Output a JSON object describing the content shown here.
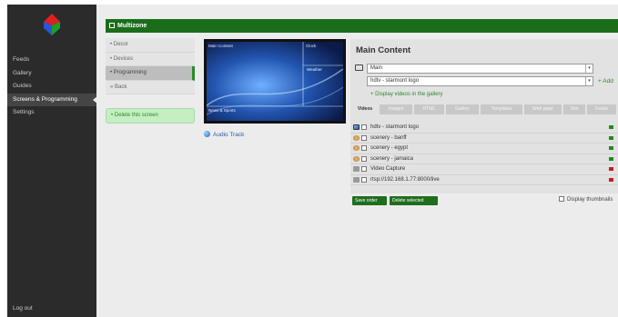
{
  "sidebar": {
    "items": [
      {
        "label": "Feeds"
      },
      {
        "label": "Gallery"
      },
      {
        "label": "Guides"
      },
      {
        "label": "Screens & Programming"
      },
      {
        "label": "Settings"
      }
    ],
    "logout_label": "Log out",
    "logo_colors": [
      "#e02020",
      "#2a55d8",
      "#1e9e2a"
    ]
  },
  "header": {
    "title": "Multizone"
  },
  "screens": {
    "items": [
      {
        "label": "• Decor"
      },
      {
        "label": "• Devices"
      },
      {
        "label": "• Programming"
      },
      {
        "label": "« Back"
      }
    ],
    "delete_label": "• Delete this screen"
  },
  "preview": {
    "zones": {
      "main": "Main Content",
      "clock": "Clock",
      "weather": "Weather",
      "ticker": "News & Sports"
    }
  },
  "audio_track_label": "Audio Track",
  "panel": {
    "title": "Main Content",
    "select_main": "Main",
    "select_item": "hdtv - starmont logo",
    "add_label": "+ Add",
    "display_videos_label": "+ Display videos in the gallery",
    "tabs": [
      "Videos",
      "Images",
      "HTML",
      "Gallery",
      "Templates",
      "Web page",
      "Text",
      "Feeds"
    ],
    "rows": [
      {
        "label": "hdtv - starmont logo",
        "icon": "image-icon",
        "status": "#1e8c1e"
      },
      {
        "label": "scenery - banff",
        "icon": "video-icon",
        "status": "#1e8c1e"
      },
      {
        "label": "scenery - egypt",
        "icon": "video-icon",
        "status": "#1e8c1e"
      },
      {
        "label": "scenery - jamaica",
        "icon": "video-icon",
        "status": "#1e8c1e"
      },
      {
        "label": "Video Capture",
        "icon": "capture-icon",
        "status": "#c41e1e"
      },
      {
        "label": "rtsp://192.168.1.77:8000/live",
        "icon": "capture-icon",
        "status": "#c41e1e"
      }
    ],
    "save_label": "Save order",
    "delete_selected_label": "Delete selected",
    "display_thumbnails_label": "Display thumbnails"
  },
  "colors": {
    "header_green": "#1c6d1a",
    "link_green": "#2c8a2a",
    "sidebar_bg": "#2b2b2b"
  }
}
